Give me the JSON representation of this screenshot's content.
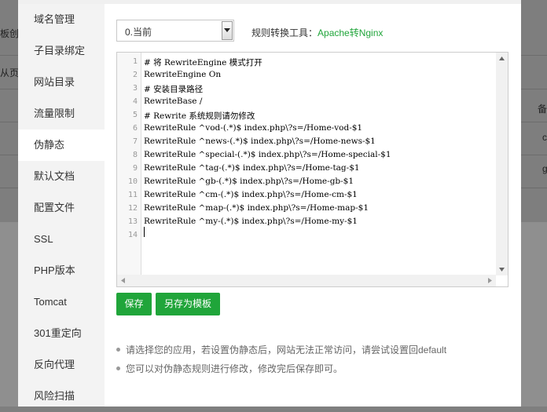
{
  "background": {
    "fragments": [
      "板创",
      "从页",
      "备",
      "c",
      "g"
    ]
  },
  "sidebar": {
    "items": [
      {
        "label": "域名管理"
      },
      {
        "label": "子目录绑定"
      },
      {
        "label": "网站目录"
      },
      {
        "label": "流量限制"
      },
      {
        "label": "伪静态"
      },
      {
        "label": "默认文档"
      },
      {
        "label": "配置文件"
      },
      {
        "label": "SSL"
      },
      {
        "label": "PHP版本"
      },
      {
        "label": "Tomcat"
      },
      {
        "label": "301重定向"
      },
      {
        "label": "反向代理"
      },
      {
        "label": "风险扫描"
      }
    ],
    "active_index": 4
  },
  "rule_select": {
    "value": "0.当前"
  },
  "converter": {
    "label": "规则转换工具：",
    "link": "Apache转Nginx",
    "link_color": "#20a53a"
  },
  "editor": {
    "lines": [
      {
        "num": "1",
        "text": "# 将 RewriteEngine 模式打开"
      },
      {
        "num": "2",
        "text": "RewriteEngine On"
      },
      {
        "num": "3",
        "text": "# 安装目录路径"
      },
      {
        "num": "4",
        "text": "RewriteBase /"
      },
      {
        "num": "5",
        "text": "# Rewrite 系统规则请勿修改"
      },
      {
        "num": "6",
        "text": "RewriteRule ^vod-(.*)$ index.php\\?s=/Home-vod-$1"
      },
      {
        "num": "7",
        "text": "RewriteRule ^news-(.*)$ index.php\\?s=/Home-news-$1"
      },
      {
        "num": "8",
        "text": "RewriteRule ^special-(.*)$ index.php\\?s=/Home-special-$1"
      },
      {
        "num": "9",
        "text": "RewriteRule ^tag-(.*)$ index.php\\?s=/Home-tag-$1"
      },
      {
        "num": "10",
        "text": "RewriteRule ^gb-(.*)$ index.php\\?s=/Home-gb-$1"
      },
      {
        "num": "11",
        "text": "RewriteRule ^cm-(.*)$ index.php\\?s=/Home-cm-$1"
      },
      {
        "num": "12",
        "text": "RewriteRule ^map-(.*)$ index.php\\?s=/Home-map-$1"
      },
      {
        "num": "13",
        "text": "RewriteRule ^my-(.*)$ index.php\\?s=/Home-my-$1"
      },
      {
        "num": "14",
        "text": ""
      }
    ]
  },
  "buttons": {
    "save": "保存",
    "save_as_template": "另存为模板",
    "color": "#20a53a"
  },
  "tips": [
    "请选择您的应用，若设置伪静态后，网站无法正常访问，请尝试设置回default",
    "您可以对伪静态规则进行修改，修改完后保存即可。"
  ]
}
